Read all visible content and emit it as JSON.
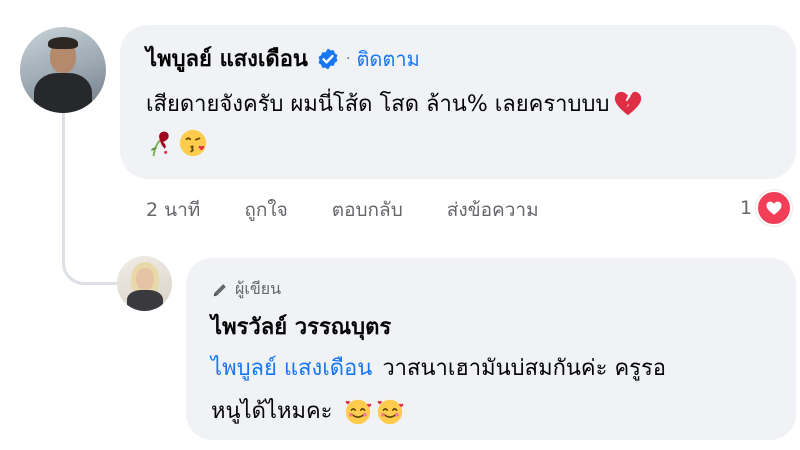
{
  "comment": {
    "author": "ไพบูลย์ แสงเดือน",
    "separator": "·",
    "follow_label": "ติดตาม",
    "text": "เสียดายจังครับ ผมนี่โส้ด โสด ล้าน% เลยคราบบบ",
    "emojis": [
      "broken-heart",
      "wilted-rose",
      "face-blowing-kiss"
    ],
    "time": "2 นาที",
    "like_label": "ถูกใจ",
    "reply_label": "ตอบกลับ",
    "message_label": "ส่งข้อความ",
    "reaction_count": "1",
    "reaction_type": "heart"
  },
  "reply": {
    "author_tag": "ผู้เขียน",
    "author": "ไพรวัลย์ วรรณบุตร",
    "mention": "ไพบูลย์ แสงเดือน",
    "text_line1": "วาสนาเฮามันบ่สมกันค่ะ ครูรอ",
    "text_line2": "หนูได้ไหมคะ",
    "emojis": [
      "smiling-face-with-hearts",
      "smiling-face-with-hearts"
    ]
  },
  "colors": {
    "bubble": "#f0f2f5",
    "link_blue": "#1877f2",
    "heart_red": "#f33e58",
    "secondary_text": "#65676b"
  }
}
